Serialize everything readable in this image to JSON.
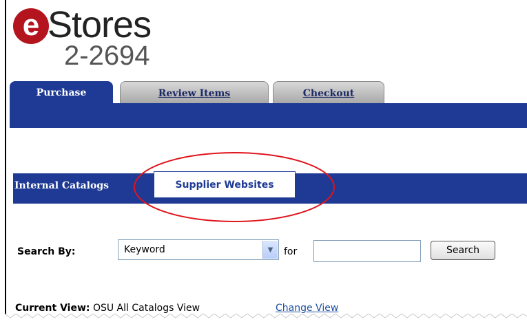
{
  "logo": {
    "letter": "e",
    "word": "Stores",
    "number": "2-2694"
  },
  "tabs": [
    {
      "label": "Purchase",
      "active": true
    },
    {
      "label": "Review Items",
      "active": false
    },
    {
      "label": "Checkout",
      "active": false
    }
  ],
  "subtabs": [
    {
      "label": "Internal Catalogs"
    },
    {
      "label": "Supplier Websites",
      "highlighted": true
    }
  ],
  "search": {
    "label": "Search By:",
    "select_value": "Keyword",
    "for_label": "for",
    "input_value": "",
    "button_label": "Search"
  },
  "current_view": {
    "label": "Current View:",
    "value": "OSU All Catalogs View",
    "change_link": "Change View"
  },
  "colors": {
    "nav_blue": "#1e3a94",
    "logo_red": "#b3141d",
    "annotation_red": "#e0141b",
    "link_blue": "#1d4f9e"
  },
  "icons": {
    "dropdown": "chevron-down-icon"
  }
}
